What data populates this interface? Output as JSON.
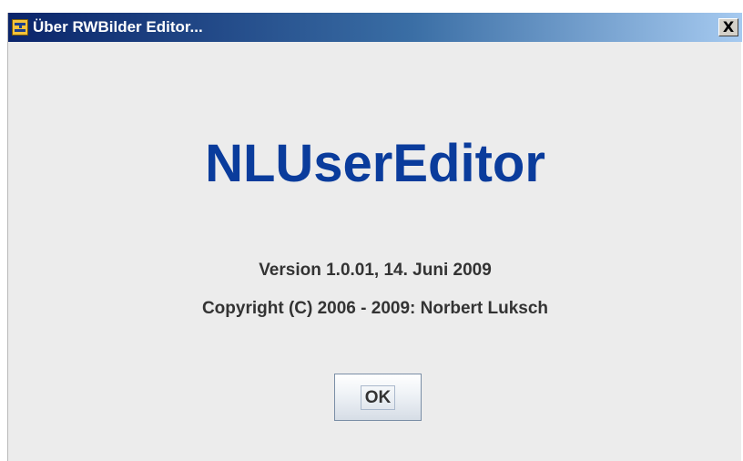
{
  "window": {
    "title": "Über RWBilder Editor...",
    "close_label": "X",
    "app_icon": "app-icon"
  },
  "content": {
    "app_name": "NLUserEditor",
    "version": "Version 1.0.01, 14. Juni 2009",
    "copyright": "Copyright (C) 2006 - 2009: Norbert Luksch"
  },
  "buttons": {
    "ok_label": "OK"
  },
  "colors": {
    "title_bar_start": "#0a246a",
    "title_bar_end": "#a6caf0",
    "app_name": "#0a3c9c",
    "dialog_background": "#ececec"
  }
}
